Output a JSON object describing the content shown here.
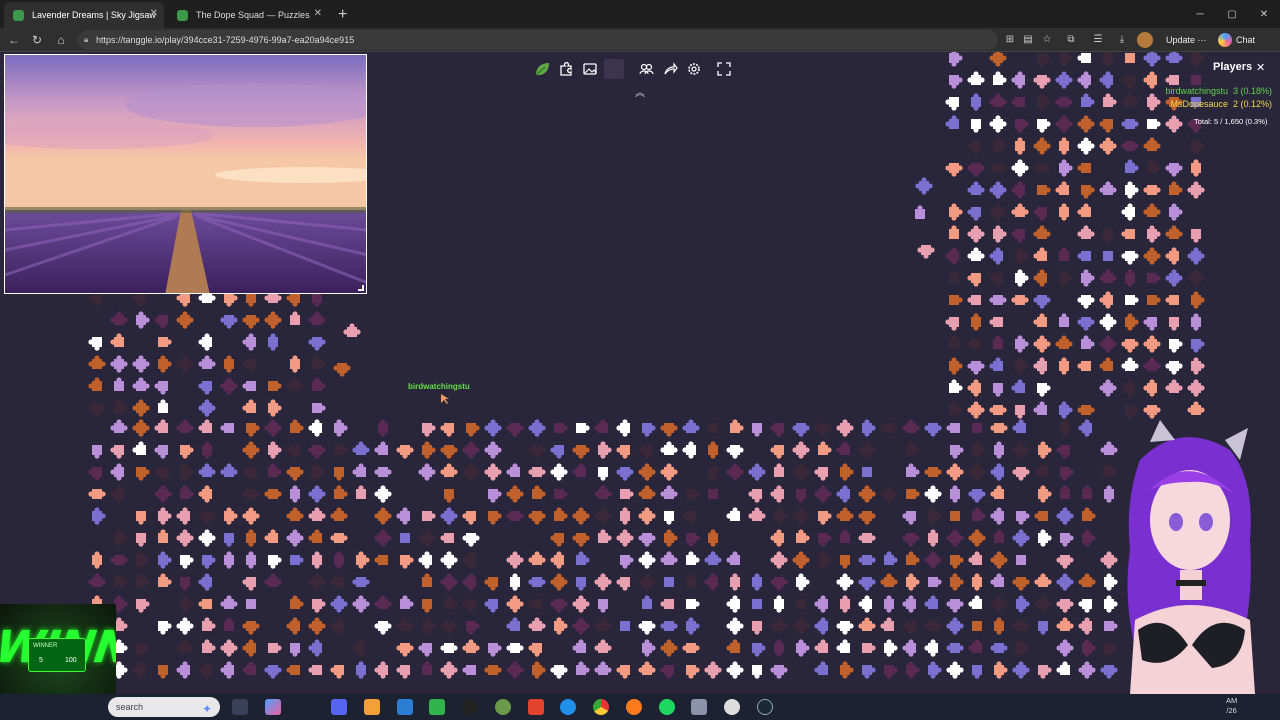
{
  "browser": {
    "tabs": [
      {
        "title": "Lavender Dreams | Sky Jigsaw",
        "active": true
      },
      {
        "title": "The Dope Squad — Puzzles",
        "active": false
      }
    ],
    "url": "https://tanggle.io/play/394cce31-7259-4976-99a7-ea20a94ce915",
    "update_label": "Update",
    "more_label": "···",
    "chat_label": "Chat",
    "window_controls": [
      "minimize",
      "maximize",
      "close"
    ]
  },
  "game": {
    "toolbar_icons": [
      "leaf-logo-icon",
      "puzzle-edges-icon",
      "image-preview-icon",
      "box-icon",
      "players-icon",
      "share-icon",
      "settings-icon",
      "fullscreen-icon"
    ],
    "players_panel": {
      "title": "Players",
      "players": [
        {
          "name": "birdwatchingstu",
          "score": "3 (0.18%)",
          "color": "#5fd34a"
        },
        {
          "name": "MsDopesauce",
          "score": "2 (0.12%)",
          "color": "#f3d94b"
        }
      ],
      "total": "Total: 5 / 1,650 (0.3%)"
    },
    "cursor_label": "birdwatchingstu",
    "piece_palette": [
      "#ffffff",
      "#f39a82",
      "#7b6fd0",
      "#b88fd8",
      "#3a2838",
      "#5a2a55",
      "#e8a0b0",
      "#c0602a"
    ]
  },
  "overlay": {
    "widget_text": "WINNER",
    "widget_chip_title": "WINNER",
    "widget_chip_left": "5",
    "widget_chip_right": "100"
  },
  "taskbar": {
    "search_placeholder": "search",
    "clock_line1": "AM",
    "clock_line2": "/26"
  }
}
